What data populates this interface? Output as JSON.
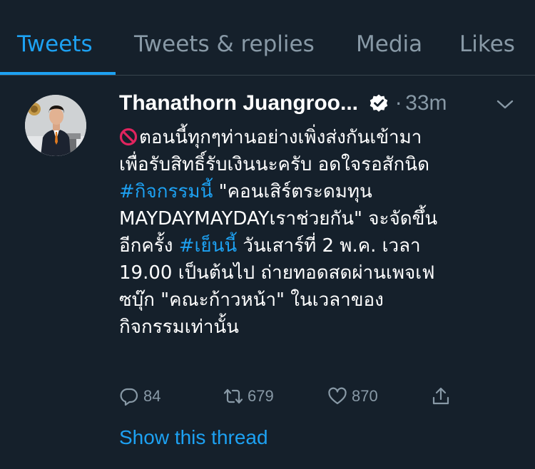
{
  "tabs": [
    {
      "label": "Tweets",
      "active": true
    },
    {
      "label": "Tweets & replies",
      "active": false
    },
    {
      "label": "Media",
      "active": false
    },
    {
      "label": "Likes",
      "active": false
    }
  ],
  "tweet": {
    "author_name": "Thanathorn Juangroo...",
    "separator": "·",
    "time": "33m",
    "verified": true,
    "lines": {
      "l1": "ตอนนี้ทุกๆท่านอย่างเพิ่งส่งกันเข้ามา",
      "l2": "เพื่อรับสิทธิ์รับเงินนะครับ อดใจรอสักนิด",
      "l3_tag": "#กิจกรรมนี้",
      "l3_rest": " \"คอนเสิร์ตระดมทุน",
      "l4": "MAYDAYMAYDAYเราช่วยกัน\" จะจัดขึ้น",
      "l5_pre": "อีกครั้ง ",
      "l5_tag": "#เย็นนี้",
      "l5_rest": " วันเสาร์ที่ 2 พ.ค. เวลา",
      "l6": "19.00 เป็นต้นไป ถ่ายทอดสดผ่านเพจเฟ",
      "l7": "ซบุ๊ก \"คณะก้าวหน้า\" ในเวลาของ",
      "l8": "กิจกรรมเท่านั้น"
    },
    "icons": {
      "prefix": "no-entry-icon",
      "verified": "verified-badge-icon",
      "caret": "chevron-down-icon",
      "reply": "reply-icon",
      "retweet": "retweet-icon",
      "like": "heart-icon",
      "share": "share-icon"
    },
    "reply_count": "84",
    "retweet_count": "679",
    "like_count": "870",
    "show_thread": "Show this thread"
  },
  "colors": {
    "background": "#15202b",
    "accent": "#1da1f2",
    "muted": "#8899a6",
    "divider": "#38444d"
  }
}
